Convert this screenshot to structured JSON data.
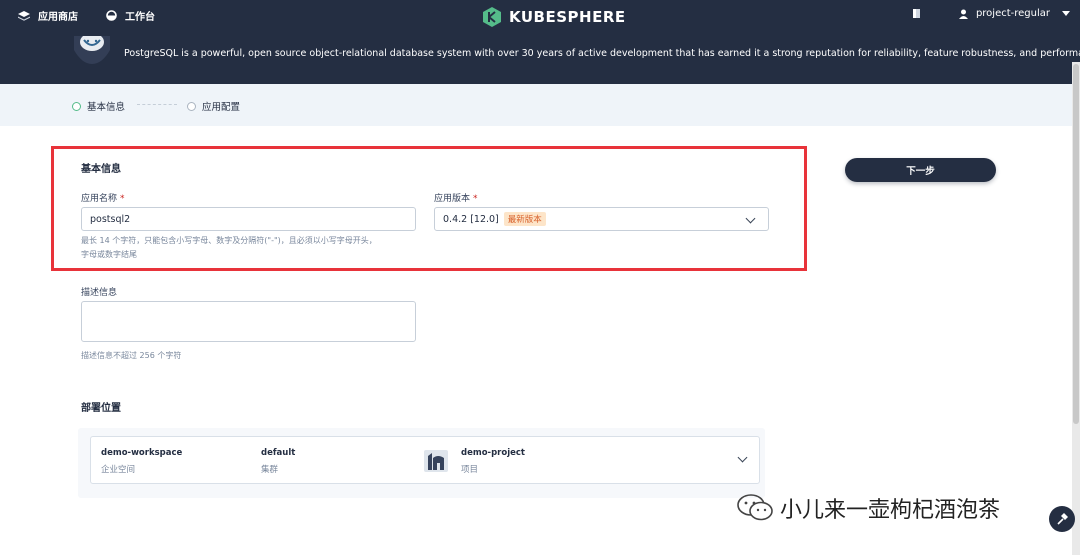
{
  "topbar": {
    "app_store_label": "应用商店",
    "workbench_label": "工作台",
    "logo_text": "KUBESPHERE",
    "username": "project-regular",
    "app_description": "PostgreSQL is a powerful, open source object-relational database system with over 30 years of active development that has earned it a strong reputation for reliability, feature robustness, and performance."
  },
  "steps": [
    {
      "label": "基本信息",
      "active": true
    },
    {
      "label": "应用配置",
      "active": false
    }
  ],
  "form": {
    "section_title": "基本信息",
    "name_label": "应用名称",
    "name_value": "postsql2",
    "name_hint_line1": "最长 14 个字符，只能包含小写字母、数字及分隔符(\"-\")，且必须以小写字母开头，",
    "name_hint_line2": "字母或数字结尾",
    "version_label": "应用版本",
    "version_value": "0.4.2 [12.0]",
    "version_tag": "最新版本",
    "desc_label": "描述信息",
    "desc_value": "",
    "desc_hint": "描述信息不超过 256 个字符",
    "required_mark": "*"
  },
  "next_button": "下一步",
  "deploy": {
    "section_title": "部署位置",
    "workspace": {
      "value": "demo-workspace",
      "sub": "企业空间"
    },
    "cluster": {
      "value": "default",
      "sub": "集群"
    },
    "project": {
      "value": "demo-project",
      "sub": "项目"
    }
  },
  "watermark": "小儿来一壶枸杞酒泡茶",
  "colors": {
    "dark": "#242e42",
    "accent_green": "#55bc8a",
    "highlight_red": "#e8333a",
    "tag_bg": "#fde5c9"
  }
}
